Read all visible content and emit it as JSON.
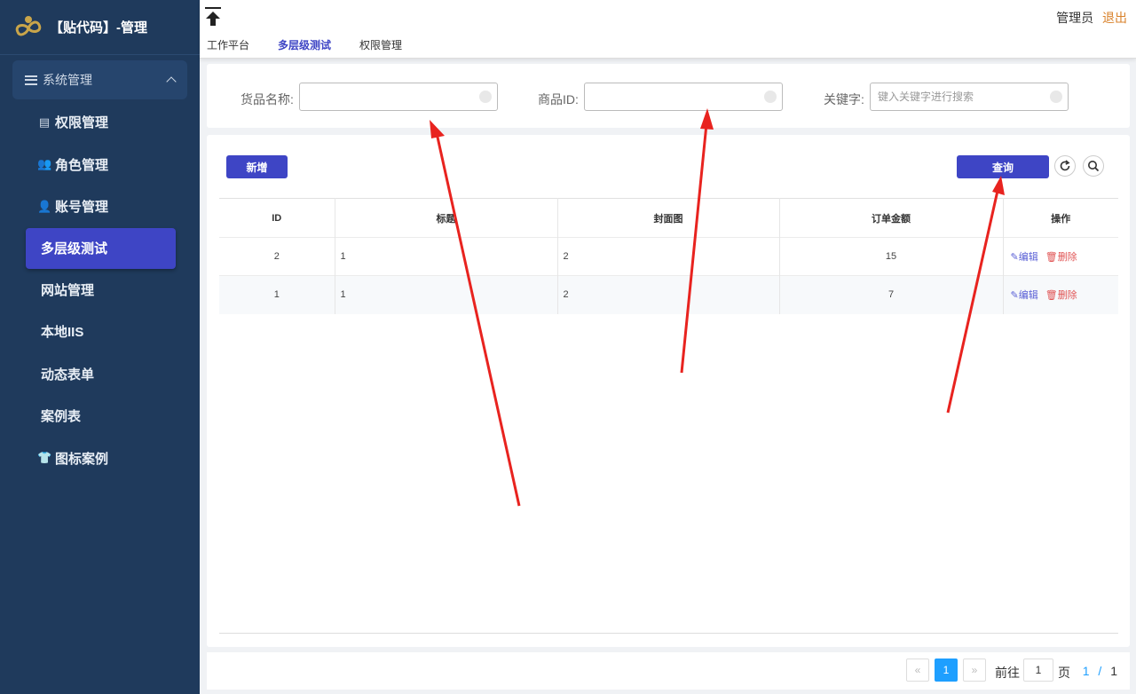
{
  "brand": {
    "title": "【贴代码】-管理"
  },
  "sidebar": {
    "group_label": "系统管理",
    "items": [
      {
        "label": "权限管理",
        "icon": "id-card-icon",
        "glyph": "▤"
      },
      {
        "label": "角色管理",
        "icon": "users-icon",
        "glyph": "👥"
      },
      {
        "label": "账号管理",
        "icon": "user-icon",
        "glyph": "👤"
      },
      {
        "label": "多层级测试",
        "icon": "",
        "glyph": ""
      },
      {
        "label": "网站管理",
        "icon": "",
        "glyph": ""
      },
      {
        "label": "本地IIS",
        "icon": "",
        "glyph": ""
      },
      {
        "label": "动态表单",
        "icon": "",
        "glyph": ""
      },
      {
        "label": "案例表",
        "icon": "",
        "glyph": ""
      },
      {
        "label": "图标案例",
        "icon": "tshirt-icon",
        "glyph": "👕"
      }
    ]
  },
  "topbar": {
    "tabs": [
      "工作平台",
      "多层级测试",
      "权限管理"
    ],
    "user": "管理员",
    "logout": "退出"
  },
  "filters": {
    "name_label": "货品名称:",
    "id_label": "商品ID:",
    "keyword_label": "关键字:",
    "keyword_placeholder": "键入关键字进行搜索"
  },
  "toolbar": {
    "add": "新增",
    "query": "查询"
  },
  "table": {
    "headers": [
      "ID",
      "标题",
      "封面图",
      "订单金额",
      "操作"
    ],
    "rows": [
      {
        "id": "2",
        "title": "1",
        "cover": "2",
        "amount": "15"
      },
      {
        "id": "1",
        "title": "1",
        "cover": "2",
        "amount": "7"
      }
    ],
    "edit": "编辑",
    "delete": "删除"
  },
  "pager": {
    "prev": "«",
    "current": "1",
    "next": "»",
    "goto": "前往",
    "page_input": "1",
    "page_unit": "页",
    "count_current": "1",
    "count_sep": "/",
    "count_total": "1"
  },
  "colors": {
    "sidebar": "#1f3a5c",
    "accent": "#3e45c5",
    "pager": "#1e9fff",
    "logout": "#d9822b",
    "delete": "#e05454",
    "arrow": "#e8231f"
  }
}
